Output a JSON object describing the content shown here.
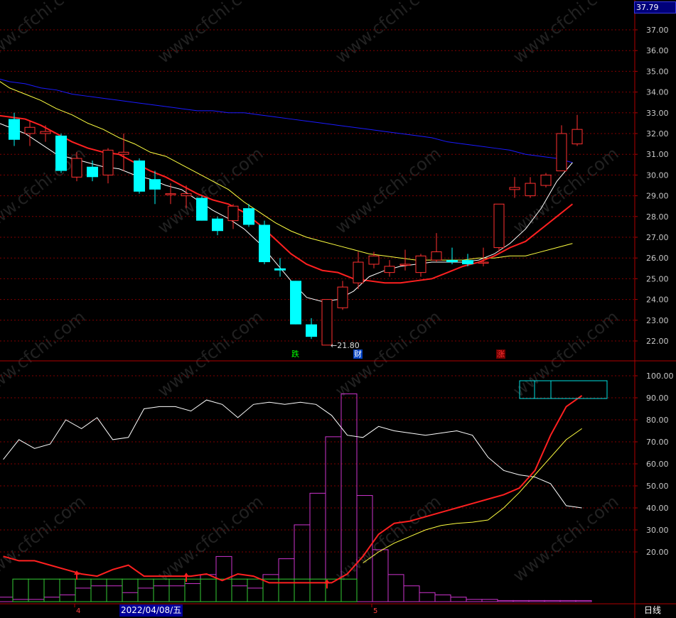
{
  "header": {
    "last_price": "37.79"
  },
  "footer": {
    "date": "2022/04/08/五",
    "mode": "日线"
  },
  "markers": [
    {
      "text": "跌",
      "color": "#00ff00"
    },
    {
      "text": "财",
      "color": "#ffffff"
    },
    {
      "text": "涨",
      "color": "#ff3030"
    }
  ],
  "watermark": "www.cfchi.com",
  "colors": {
    "up": "#ff3030",
    "down": "#00ffff",
    "ma_blue": "#1a1aff",
    "ma_yellow": "#ffff40",
    "ma_red": "#ff2020",
    "grid": "#800000",
    "purple": "#cc33cc",
    "green": "#33cc33"
  },
  "chart_data": [
    {
      "type": "candlestick",
      "ylim": [
        21.5,
        38.0
      ],
      "y_ticks": [
        "37.00",
        "36.00",
        "35.00",
        "34.00",
        "33.00",
        "32.00",
        "31.00",
        "30.00",
        "29.00",
        "28.00",
        "27.00",
        "26.00",
        "25.00",
        "24.00",
        "23.00",
        "22.00"
      ],
      "low_label": "21.80",
      "x_ticks": [
        {
          "label": "4",
          "index": 4.5
        },
        {
          "label": "5",
          "index": 23.5
        }
      ],
      "candles": [
        {
          "o": 32.7,
          "h": 33.0,
          "l": 31.4,
          "c": 31.7
        },
        {
          "o": 32.0,
          "h": 32.6,
          "l": 31.4,
          "c": 32.3
        },
        {
          "o": 32.0,
          "h": 32.4,
          "l": 31.6,
          "c": 32.1
        },
        {
          "o": 31.9,
          "h": 32.0,
          "l": 30.1,
          "c": 30.2
        },
        {
          "o": 29.9,
          "h": 31.1,
          "l": 29.7,
          "c": 30.8
        },
        {
          "o": 30.4,
          "h": 30.7,
          "l": 29.7,
          "c": 29.9
        },
        {
          "o": 30.0,
          "h": 31.3,
          "l": 29.6,
          "c": 31.2
        },
        {
          "o": 31.0,
          "h": 32.0,
          "l": 30.2,
          "c": 31.1
        },
        {
          "o": 30.7,
          "h": 30.8,
          "l": 29.1,
          "c": 29.2
        },
        {
          "o": 29.8,
          "h": 30.2,
          "l": 28.6,
          "c": 29.3
        },
        {
          "o": 29.1,
          "h": 29.6,
          "l": 28.6,
          "c": 29.1
        },
        {
          "o": 29.0,
          "h": 29.5,
          "l": 28.4,
          "c": 29.1
        },
        {
          "o": 28.9,
          "h": 29.0,
          "l": 27.8,
          "c": 27.8
        },
        {
          "o": 27.9,
          "h": 28.0,
          "l": 27.1,
          "c": 27.3
        },
        {
          "o": 27.8,
          "h": 28.6,
          "l": 27.4,
          "c": 28.5
        },
        {
          "o": 28.4,
          "h": 28.6,
          "l": 27.5,
          "c": 27.6
        },
        {
          "o": 27.6,
          "h": 27.8,
          "l": 25.7,
          "c": 25.8
        },
        {
          "o": 25.5,
          "h": 26.0,
          "l": 25.1,
          "c": 25.4
        },
        {
          "o": 24.9,
          "h": 24.9,
          "l": 22.8,
          "c": 22.8
        },
        {
          "o": 22.8,
          "h": 23.1,
          "l": 22.1,
          "c": 22.2
        },
        {
          "o": 21.8,
          "h": 24.0,
          "l": 21.8,
          "c": 24.0
        },
        {
          "o": 23.6,
          "h": 24.9,
          "l": 23.5,
          "c": 24.6
        },
        {
          "o": 24.8,
          "h": 26.3,
          "l": 24.5,
          "c": 25.8
        },
        {
          "o": 25.7,
          "h": 26.3,
          "l": 25.5,
          "c": 26.1
        },
        {
          "o": 25.3,
          "h": 25.9,
          "l": 25.1,
          "c": 25.6
        },
        {
          "o": 25.7,
          "h": 26.4,
          "l": 25.4,
          "c": 25.7
        },
        {
          "o": 25.3,
          "h": 26.2,
          "l": 25.1,
          "c": 26.1
        },
        {
          "o": 25.9,
          "h": 27.2,
          "l": 25.8,
          "c": 26.3
        },
        {
          "o": 25.9,
          "h": 26.5,
          "l": 25.7,
          "c": 25.8
        },
        {
          "o": 25.9,
          "h": 26.2,
          "l": 25.6,
          "c": 25.7
        },
        {
          "o": 25.8,
          "h": 26.5,
          "l": 25.6,
          "c": 25.8
        },
        {
          "o": 26.5,
          "h": 28.6,
          "l": 26.3,
          "c": 28.6
        },
        {
          "o": 29.3,
          "h": 29.9,
          "l": 28.9,
          "c": 29.4
        },
        {
          "o": 29.0,
          "h": 29.9,
          "l": 28.9,
          "c": 29.6
        },
        {
          "o": 29.5,
          "h": 30.1,
          "l": 29.4,
          "c": 30.0
        },
        {
          "o": 30.2,
          "h": 32.4,
          "l": 30.2,
          "c": 32.0
        },
        {
          "o": 31.5,
          "h": 32.9,
          "l": 31.4,
          "c": 32.2
        }
      ],
      "ma": [
        {
          "color": "#1a1aff",
          "width": 1,
          "x0": -1.3,
          "values": [
            34.7,
            34.5,
            34.4,
            34.2,
            34.1,
            33.9,
            33.8,
            33.7,
            33.6,
            33.5,
            33.4,
            33.3,
            33.2,
            33.1,
            33.1,
            33.0,
            33.0,
            32.9,
            32.8,
            32.7,
            32.6,
            32.5,
            32.4,
            32.3,
            32.2,
            32.1,
            32.0,
            31.9,
            31.8,
            31.6,
            31.5,
            31.4,
            31.3,
            31.2,
            31.0,
            30.9,
            30.8,
            30.6
          ]
        },
        {
          "color": "#ffff40",
          "width": 1,
          "x0": -1.3,
          "values": [
            34.7,
            34.2,
            33.9,
            33.6,
            33.2,
            32.9,
            32.5,
            32.2,
            31.8,
            31.5,
            31.1,
            30.9,
            30.5,
            30.1,
            29.7,
            29.3,
            28.7,
            28.2,
            27.7,
            27.3,
            27.0,
            26.8,
            26.6,
            26.4,
            26.2,
            26.1,
            26.0,
            25.9,
            25.9,
            25.9,
            25.9,
            26.0,
            26.0,
            26.1,
            26.1,
            26.3,
            26.5,
            26.7
          ]
        },
        {
          "color": "#ff2020",
          "width": 2,
          "x0": -1.3,
          "values": [
            32.9,
            32.8,
            32.7,
            32.4,
            32.0,
            31.6,
            31.3,
            31.1,
            31.0,
            30.6,
            30.2,
            29.9,
            29.5,
            29.1,
            28.8,
            28.6,
            28.2,
            27.6,
            26.9,
            26.2,
            25.7,
            25.4,
            25.3,
            25.0,
            24.9,
            24.8,
            24.8,
            24.9,
            25.0,
            25.3,
            25.6,
            25.8,
            26.1,
            26.5,
            26.8,
            27.4,
            28.0,
            28.6
          ]
        },
        {
          "color": "#ffffff",
          "width": 1,
          "x0": -1.3,
          "values": [
            32.6,
            32.3,
            32.0,
            31.5,
            31.0,
            30.8,
            30.6,
            30.4,
            30.3,
            30.0,
            29.8,
            29.5,
            29.3,
            28.8,
            28.3,
            27.9,
            27.4,
            26.7,
            25.8,
            24.9,
            24.1,
            23.9,
            24.0,
            24.4,
            25.1,
            25.4,
            25.6,
            25.7,
            25.8,
            25.8,
            25.8,
            25.9,
            26.2,
            26.7,
            27.4,
            28.4,
            29.7,
            30.6
          ]
        }
      ]
    },
    {
      "type": "indicator",
      "ylim": [
        0,
        100
      ],
      "y_ticks": [
        "100.00",
        "90.00",
        "80.00",
        "70.00",
        "60.00",
        "50.00",
        "40.00",
        "30.00",
        "20.00"
      ],
      "white_line": {
        "color": "#ffffff",
        "x0": -0.7,
        "values": [
          62,
          71,
          67,
          69,
          80,
          76,
          81,
          71,
          72,
          85,
          86,
          86,
          84,
          89,
          87,
          81,
          87,
          88,
          87,
          88,
          87,
          82,
          73,
          72,
          77,
          75,
          74,
          73,
          74,
          75,
          73,
          63,
          57,
          55,
          54,
          51,
          41,
          40
        ]
      },
      "yellow_line": {
        "color": "#ffff40",
        "x0": 22.3,
        "values": [
          15,
          20,
          24,
          27,
          30,
          32,
          33,
          33.5,
          34.5,
          40,
          47,
          55,
          63,
          71,
          76
        ]
      },
      "red_line": {
        "color": "#ff2020",
        "x0": -0.7,
        "values": [
          18,
          16,
          16,
          14,
          12,
          10,
          9,
          12,
          14,
          9,
          9,
          9,
          9,
          10,
          7,
          10,
          9,
          6,
          6,
          6,
          6,
          6,
          10,
          18,
          28,
          33,
          34,
          36,
          38,
          40,
          42,
          44,
          46,
          49,
          57,
          73,
          86,
          91
        ]
      },
      "red_arrows_at": [
        4,
        11,
        20
      ],
      "histogram": {
        "color": "#cc33cc",
        "values": [
          2,
          1,
          1,
          2,
          3,
          6,
          7,
          7,
          4,
          6,
          7,
          7,
          8,
          12,
          20,
          7,
          6,
          12,
          19,
          34,
          48,
          73,
          92,
          47,
          23,
          12,
          7,
          4,
          3,
          2,
          1,
          1,
          0.5,
          0.5,
          0.5,
          0.5,
          0.5,
          0.5
        ]
      },
      "green_bars": {
        "color": "#33cc33",
        "from": 1,
        "to": 22,
        "value": 10
      },
      "legend_box": {
        "border": "#00e0e0"
      }
    }
  ]
}
